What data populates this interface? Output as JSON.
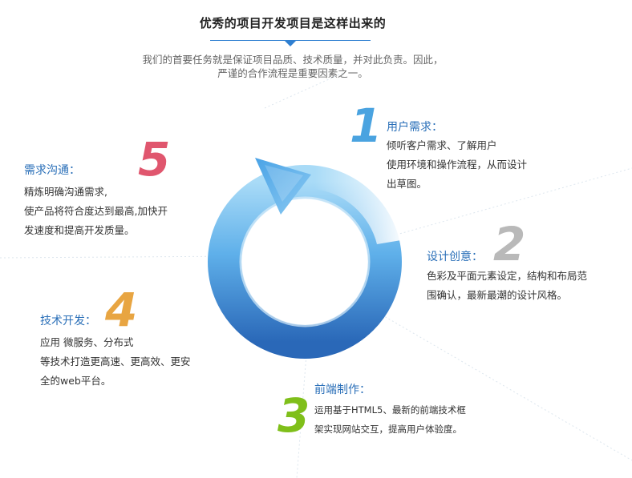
{
  "header": {
    "title": "优秀的项目开发项目是这样出来的",
    "subtitle_line1": "我们的首要任务就是保证项目品质、技术质量，并对此负责。因此，",
    "subtitle_line2": "严谨的合作流程是重要因素之一。"
  },
  "steps": [
    {
      "number": "1",
      "title": "用户需求：",
      "lines": [
        "倾听客户需求、了解用户",
        "使用环境和操作流程，从而设计",
        "出草图。"
      ],
      "color": "#4aa3e0"
    },
    {
      "number": "2",
      "title": "设计创意：",
      "lines": [
        "色彩及平面元素设定，结构和布局范",
        "围确认，最新最潮的设计风格。"
      ],
      "color": "#b9b9b9"
    },
    {
      "number": "3",
      "title": "前端制作：",
      "lines": [
        "运用基于HTML5、最新的前端技术框",
        "架实现网站交互，提高用户体验度。"
      ],
      "color": "#7fbf1a"
    },
    {
      "number": "4",
      "title": "技术开发：",
      "lines": [
        "应用 微服务、分布式",
        "等技术打造更高速、更高效、更安",
        "全的web平台。"
      ],
      "color": "#e8a542"
    },
    {
      "number": "5",
      "title": "需求沟通：",
      "lines": [
        "精炼明确沟通需求,",
        "使产品将符合度达到最高,加快开",
        "发速度和提高开发质量。"
      ],
      "color": "#e0566e"
    }
  ],
  "colors": {
    "accent": "#2f7fd1",
    "ring_light": "#9fd3f5",
    "ring_dark": "#2a68b8"
  }
}
